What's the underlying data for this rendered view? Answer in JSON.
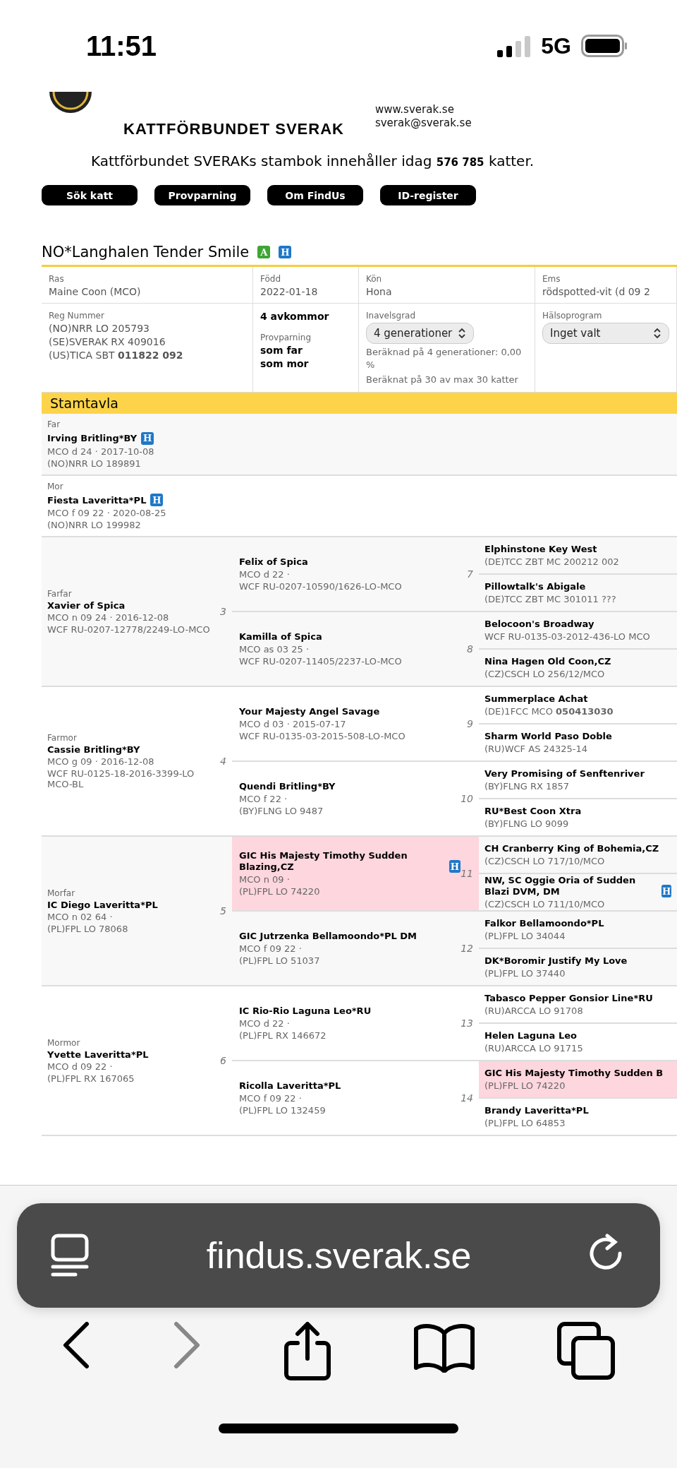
{
  "status_bar": {
    "time": "11:51",
    "network": "5G"
  },
  "header": {
    "org": "KATTFÖRBUNDET SVERAK",
    "links": [
      "www.sverak.se",
      "sverak@sverak.se"
    ],
    "stat": "Kattförbundet SVERAKs stambok innehåller idag **576 785** katter.",
    "nav": [
      "Sök katt",
      "Provparning",
      "Om FindUs",
      "ID-register"
    ]
  },
  "cat": {
    "title": "NO*Langhalen Tender Smile",
    "badges": [
      {
        "letter": "A",
        "color": "#3fa535"
      },
      {
        "letter": "H",
        "color": "#1f78c8"
      }
    ]
  },
  "info": {
    "row_1": [
      {
        "label": "Ras",
        "value": "Maine Coon (MCO)"
      },
      {
        "label": "Född",
        "value": "2022-01-18"
      },
      {
        "label": "Kön",
        "value": "Hona"
      },
      {
        "label": "Ems",
        "value": "rödspotted-vit (d 09 2"
      }
    ],
    "reg": {
      "label": "Reg Nummer",
      "lines": [
        "(NO)NRR LO 205793",
        "(SE)SVERAK RX 409016",
        "(US)TICA SBT **011822 092**"
      ]
    },
    "offspring": {
      "count": "4 avkommor",
      "label": "Provparning",
      "lines": [
        "som far",
        "som mor"
      ]
    },
    "inbreeding": {
      "label": "Inavelsgrad",
      "select": "4 generationer",
      "lines": [
        "Beräknad på 4 generationer: 0,00 %",
        "Beräknat på 30 av max 30 katter"
      ]
    },
    "health": {
      "label": "Hälsoprogram",
      "select": "Inget valt"
    }
  },
  "pedigree": {
    "title": "Stamtavla",
    "parents": [
      {
        "label": "Far",
        "name": "Irving Britling*BY",
        "badges": [
          {
            "letter": "H",
            "color": "#1f78c8"
          }
        ],
        "lines": [
          "MCO d 24 · 2017-10-08",
          "(NO)NRR LO 189891"
        ]
      },
      {
        "label": "Mor",
        "name": "Fiesta Laveritta*PL",
        "badges": [
          {
            "letter": "H",
            "color": "#1f78c8"
          }
        ],
        "lines": [
          "MCO f 09 22 · 2020-08-25",
          "(NO)NRR LO 199982"
        ]
      }
    ],
    "grandparents": [
      {
        "label": "Farfar",
        "number": "3",
        "name": "Xavier of Spica",
        "lines": [
          "MCO n 09 24 · 2016-12-08",
          "WCF RU-0207-12778/2249-LO-MCO"
        ],
        "children": [
          {
            "number": "7",
            "name": "Felix of Spica",
            "highlighted": false,
            "lines": [
              "MCO d 22 ·",
              "WCF RU-0207-10590/1626-LO-MCO"
            ],
            "children": [
              {
                "name": "Elphinstone Key West",
                "highlighted": false,
                "lines": [
                  "(DE)TCC ZBT MC 200212 002"
                ]
              },
              {
                "name": "Pillowtalk's Abigale",
                "highlighted": false,
                "lines": [
                  "(DE)TCC ZBT MC 301011 ???"
                ]
              }
            ]
          },
          {
            "number": "8",
            "name": "Kamilla of Spica",
            "highlighted": false,
            "lines": [
              "MCO as 03 25 ·",
              "WCF RU-0207-11405/2237-LO-MCO"
            ],
            "children": [
              {
                "name": "Belocoon's Broadway",
                "highlighted": false,
                "lines": [
                  "WCF RU-0135-03-2012-436-LO MCO"
                ]
              },
              {
                "name": "Nina Hagen Old Coon,CZ",
                "highlighted": false,
                "lines": [
                  "(CZ)CSCH LO 256/12/MCO"
                ]
              }
            ]
          }
        ]
      },
      {
        "label": "Farmor",
        "number": "4",
        "name": "Cassie Britling*BY",
        "lines": [
          "MCO g 09 · 2016-12-08",
          "WCF RU-0125-18-2016-3399-LO MCO-BL"
        ],
        "children": [
          {
            "number": "9",
            "name": "Your Majesty Angel Savage",
            "highlighted": false,
            "lines": [
              "MCO d 03 · 2015-07-17",
              "WCF RU-0135-03-2015-508-LO-MCO"
            ],
            "children": [
              {
                "name": "Summerplace Achat",
                "highlighted": false,
                "lines": [
                  "(DE)1FCC MCO **050413030**"
                ]
              },
              {
                "name": "Sharm World Paso Doble",
                "highlighted": false,
                "lines": [
                  "(RU)WCF AS 24325-14"
                ]
              }
            ]
          },
          {
            "number": "10",
            "name": "Quendi Britling*BY",
            "highlighted": false,
            "lines": [
              "MCO f 22 ·",
              "(BY)FLNG LO 9487"
            ],
            "children": [
              {
                "name": "Very Promising of Senftenriver",
                "highlighted": false,
                "lines": [
                  "(BY)FLNG RX 1857"
                ]
              },
              {
                "name": "RU*Best Coon Xtra",
                "highlighted": false,
                "lines": [
                  "(BY)FLNG LO 9099"
                ]
              }
            ]
          }
        ]
      },
      {
        "label": "Morfar",
        "number": "5",
        "name": "IC Diego Laveritta*PL",
        "lines": [
          "MCO n 02 64 ·",
          "(PL)FPL LO 78068"
        ],
        "children": [
          {
            "number": "11",
            "name": "GIC His Majesty Timothy Sudden Blazing,CZ",
            "highlighted": true,
            "badges": [
              {
                "letter": "H",
                "color": "#1f78c8"
              }
            ],
            "lines": [
              "MCO n 09 ·",
              "(PL)FPL LO 74220"
            ],
            "children": [
              {
                "name": "CH Cranberry King of Bohemia,CZ",
                "highlighted": false,
                "lines": [
                  "(CZ)CSCH LO 717/10/MCO"
                ]
              },
              {
                "name": "NW, SC Oggie Oria of Sudden Blazi DVM, DM",
                "highlighted": false,
                "badges": [
                  {
                    "letter": "H",
                    "color": "#1f78c8"
                  }
                ],
                "lines": [
                  "(CZ)CSCH LO 711/10/MCO"
                ]
              }
            ]
          },
          {
            "number": "12",
            "name": "GIC Jutrzenka Bellamoondo*PL DM",
            "highlighted": false,
            "lines": [
              "MCO f 09 22 ·",
              "(PL)FPL LO 51037"
            ],
            "children": [
              {
                "name": "Falkor Bellamoondo*PL",
                "highlighted": false,
                "lines": [
                  "(PL)FPL LO 34044"
                ]
              },
              {
                "name": "DK*Boromir Justify My Love",
                "highlighted": false,
                "lines": [
                  "(PL)FPL LO 37440"
                ]
              }
            ]
          }
        ]
      },
      {
        "label": "Mormor",
        "number": "6",
        "name": "Yvette Laveritta*PL",
        "lines": [
          "MCO d 09 22 ·",
          "(PL)FPL RX 167065"
        ],
        "children": [
          {
            "number": "13",
            "name": "IC Rio-Rio Laguna Leo*RU",
            "highlighted": false,
            "lines": [
              "MCO d 22 ·",
              "(PL)FPL RX 146672"
            ],
            "children": [
              {
                "name": "Tabasco Pepper Gonsior Line*RU",
                "highlighted": false,
                "lines": [
                  "(RU)ARCCA LO 91708"
                ]
              },
              {
                "name": "Helen Laguna Leo",
                "highlighted": false,
                "lines": [
                  "(RU)ARCCA LO 91715"
                ]
              }
            ]
          },
          {
            "number": "14",
            "name": "Ricolla Laveritta*PL",
            "highlighted": false,
            "lines": [
              "MCO f 09 22 ·",
              "(PL)FPL LO 132459"
            ],
            "children": [
              {
                "name": "GIC His Majesty Timothy Sudden B",
                "highlighted": true,
                "lines": [
                  "(PL)FPL LO 74220"
                ]
              },
              {
                "name": "Brandy Laveritta*PL",
                "highlighted": false,
                "lines": [
                  "(PL)FPL LO 64853"
                ]
              }
            ]
          }
        ]
      }
    ]
  },
  "browser": {
    "url": "findus.sverak.se"
  }
}
